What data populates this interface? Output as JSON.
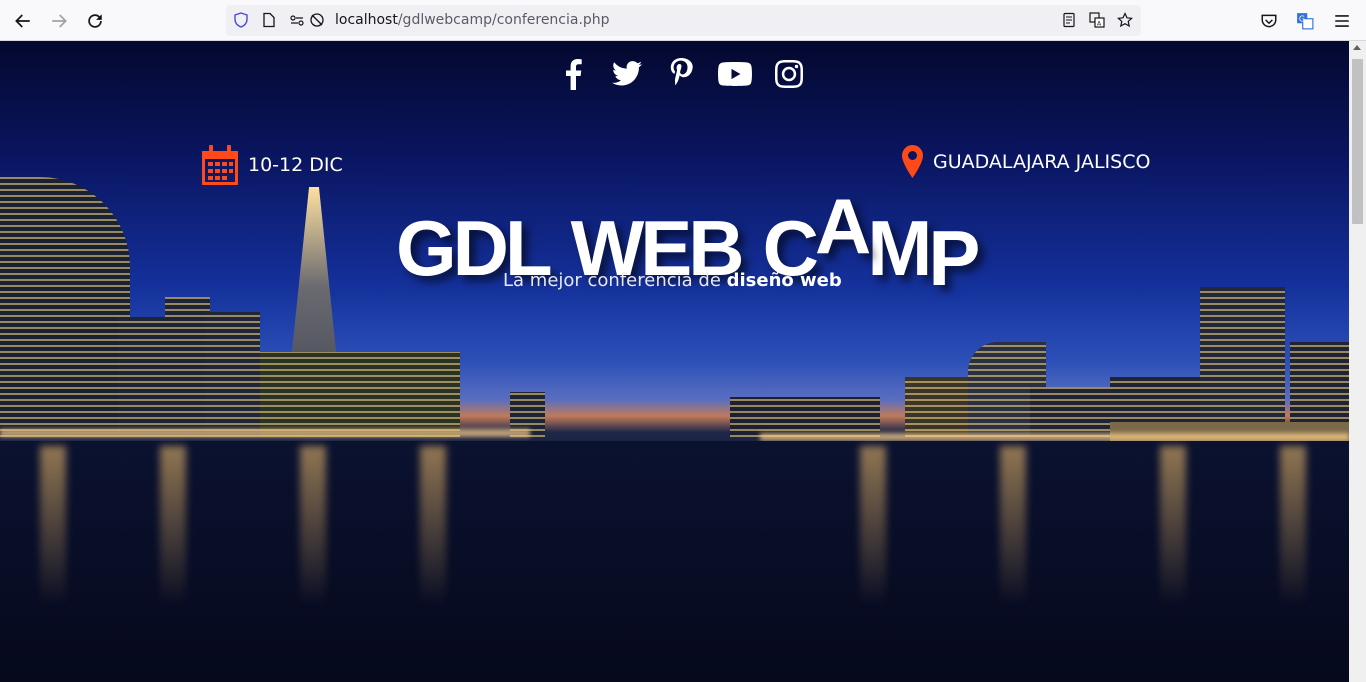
{
  "browser": {
    "url_host": "localhost",
    "url_path": "/gdlwebcamp/conferencia.php"
  },
  "social": {
    "icons": [
      "facebook-icon",
      "twitter-icon",
      "pinterest-icon",
      "youtube-icon",
      "instagram-icon"
    ]
  },
  "event": {
    "date": "10-12 DIC",
    "location": "GUADALAJARA JALISCO"
  },
  "hero": {
    "logo_parts": [
      "GDL",
      "WEB",
      "C",
      "A",
      "M",
      "P"
    ],
    "tagline_prefix": "La mejor conferencia de ",
    "tagline_bold": "diseño web"
  },
  "colors": {
    "accent": "#fe4918"
  }
}
